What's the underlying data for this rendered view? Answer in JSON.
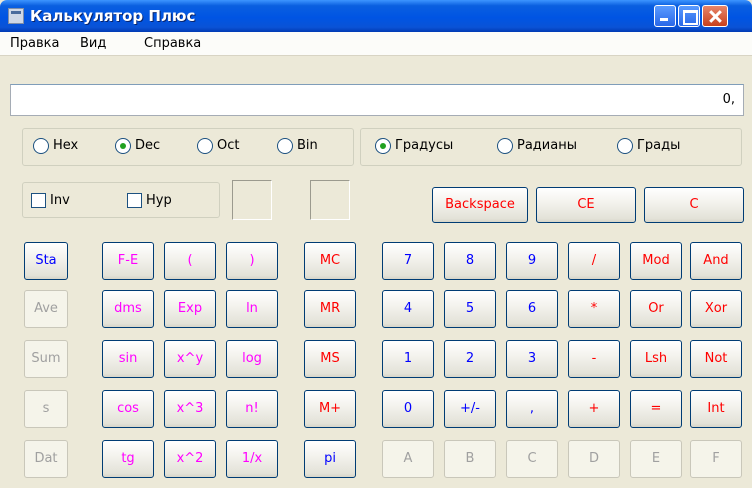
{
  "window": {
    "title": "Калькулятор Плюс"
  },
  "menu": [
    "Правка",
    "Вид",
    "Справка"
  ],
  "display": {
    "value": "0,"
  },
  "radix": {
    "options": [
      "Hex",
      "Dec",
      "Oct",
      "Bin"
    ],
    "selected": "Dec"
  },
  "angle": {
    "options": [
      "Градусы",
      "Радианы",
      "Грады"
    ],
    "selected": "Градусы"
  },
  "checkboxes": [
    {
      "label": "Inv",
      "checked": false
    },
    {
      "label": "Hyp",
      "checked": false
    }
  ],
  "controls": {
    "backspace": "Backspace",
    "ce": "CE",
    "c": "C"
  },
  "stat_buttons": [
    "Sta",
    "Ave",
    "Sum",
    "s",
    "Dat"
  ],
  "func_buttons": [
    [
      "F-E",
      "(",
      ")"
    ],
    [
      "dms",
      "Exp",
      "ln"
    ],
    [
      "sin",
      "x^y",
      "log"
    ],
    [
      "cos",
      "x^3",
      "n!"
    ],
    [
      "tg",
      "x^2",
      "1/x"
    ]
  ],
  "memory_buttons": [
    "MC",
    "MR",
    "MS",
    "M+",
    "pi"
  ],
  "keypad": [
    [
      "7",
      "8",
      "9",
      "/",
      "Mod",
      "And"
    ],
    [
      "4",
      "5",
      "6",
      "*",
      "Or",
      "Xor"
    ],
    [
      "1",
      "2",
      "3",
      "-",
      "Lsh",
      "Not"
    ],
    [
      "0",
      "+/-",
      ",",
      "+",
      "=",
      "Int"
    ]
  ],
  "hex_digits": [
    "A",
    "B",
    "C",
    "D",
    "E",
    "F"
  ],
  "colors": {
    "title_bar": "#0054e3",
    "blue_text": "#0000ff",
    "red_text": "#ff0000",
    "magenta_text": "#ff00ff",
    "disabled_text": "#a0a0a0",
    "radio_dot": "#21a121"
  }
}
